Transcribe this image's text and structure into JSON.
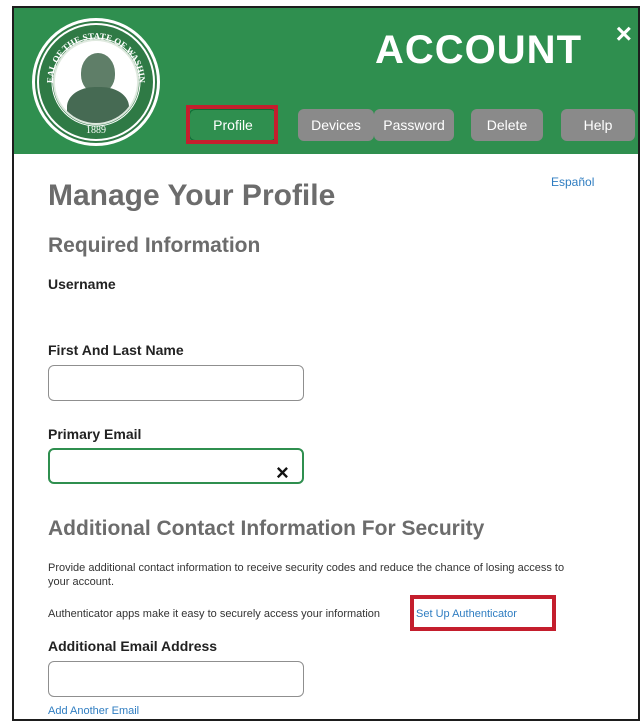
{
  "header": {
    "title": "ACCOUNT",
    "close_label": "×",
    "seal": {
      "icon": "washington-state-seal-icon",
      "ring_text": "THE SEAL OF THE STATE OF WASHINGTON",
      "year": "1889"
    },
    "tabs": [
      {
        "label": "Profile",
        "active": true
      },
      {
        "label": "Devices",
        "active": false
      },
      {
        "label": "Password",
        "active": false
      },
      {
        "label": "Delete",
        "active": false
      },
      {
        "label": "Help",
        "active": false
      }
    ]
  },
  "language_link": "Español",
  "page_title": "Manage Your Profile",
  "required": {
    "heading": "Required Information",
    "username_label": "Username",
    "username_value": "",
    "name_label": "First And Last Name",
    "name_value": "",
    "email_label": "Primary Email",
    "email_value": "",
    "clear_label": "×"
  },
  "additional": {
    "heading": "Additional Contact Information For Security",
    "description": "Provide additional contact information to receive security codes and reduce the chance of losing access to your account.",
    "authenticator_text": "Authenticator apps make it easy to securely access your information",
    "authenticator_link": "Set Up Authenticator",
    "email_label": "Additional Email Address",
    "email_value": "",
    "add_email_link": "Add Another Email"
  },
  "colors": {
    "header_green": "#2f8f4f",
    "tab_gray": "#8a8a8a",
    "highlight_red": "#c41e2d",
    "link_blue": "#2f7dc1"
  }
}
